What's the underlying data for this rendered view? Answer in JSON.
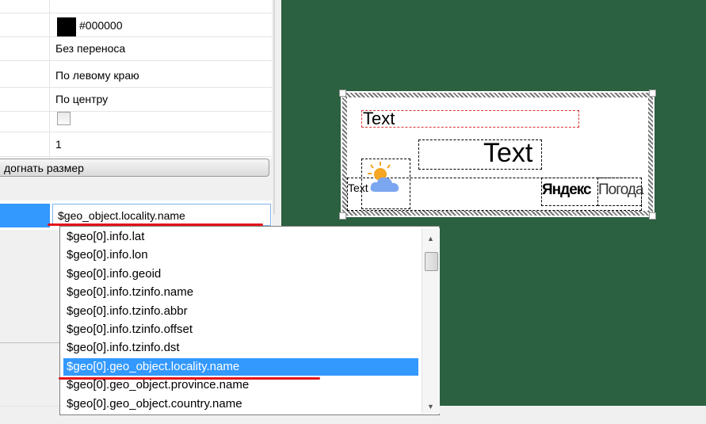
{
  "properties": {
    "color_value": "#000000",
    "wrap": "Без переноса",
    "h_align": "По левому краю",
    "v_align": "По центру",
    "checkbox_checked": false,
    "number": "1",
    "fit_button": "догнать размер"
  },
  "field": {
    "value": "$geo_object.locality.name"
  },
  "dropdown": {
    "items": [
      "$geo[0].info.lat",
      "$geo[0].info.lon",
      "$geo[0].info.geoid",
      "$geo[0].info.tzinfo.name",
      "$geo[0].info.tzinfo.abbr",
      "$geo[0].info.tzinfo.offset",
      "$geo[0].info.tzinfo.dst",
      "$geo[0].geo_object.locality.name",
      "$geo[0].geo_object.province.name",
      "$geo[0].geo_object.country.name"
    ],
    "selected_index": 7
  },
  "canvas": {
    "background": "#2b6041",
    "text_small": "Text",
    "text_large": "Text",
    "text_icon": "Text",
    "brand": "Яндекс",
    "brand_suffix": "Погода",
    "icon": "sun-cloud-icon"
  }
}
